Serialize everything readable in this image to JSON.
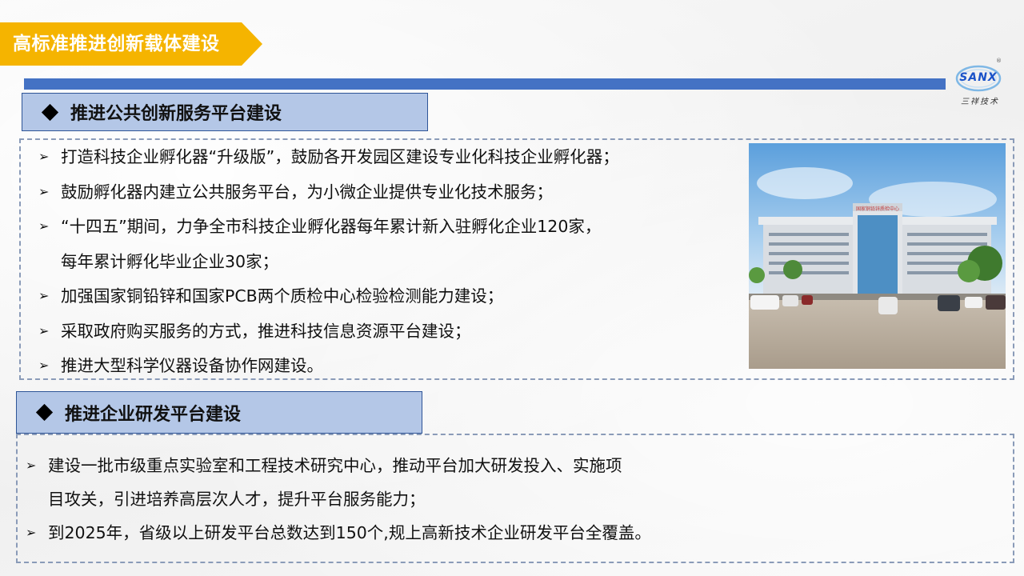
{
  "header": {
    "title": "高标准推进创新载体建设"
  },
  "logo": {
    "brand": "SANX",
    "registered_mark": "®",
    "subtitle": "三祥技术"
  },
  "section1": {
    "heading": "推进公共创新服务平台建设",
    "bullets": [
      "打造科技企业孵化器“升级版”，鼓励各开发园区建设专业化科技企业孵化器；",
      "鼓励孵化器内建立公共服务平台，为小微企业提供专业化技术服务；",
      "“十四五”期间，力争全市科技企业孵化器每年累计新入驻孵化企业120家，",
      "每年累计孵化毕业企业30家；",
      "加强国家铜铅锌和国家PCB两个质检中心检验检测能力建设；",
      "采取政府购买服务的方式，推进科技信息资源平台建设；",
      "推进大型科学仪器设备协作网建设。"
    ],
    "photo_sign": "国家铜铅锌质检中心"
  },
  "section2": {
    "heading": "推进企业研发平台建设",
    "bullets": [
      "建设一批市级重点实验室和工程技术研究中心，推动平台加大研发投入、实施项",
      "目攻关，引进培养高层次人才，提升平台服务能力；",
      "到2025年，省级以上研发平台总数达到150个,规上高新技术企业研发平台全覆盖。"
    ]
  },
  "colors": {
    "title_banner": "#f5b400",
    "rule": "#4472c4",
    "section_header_fill": "#b4c7e7",
    "section_header_border": "#2f5597",
    "box_border": "#8a9bb8"
  },
  "icons": {
    "section_marker": "diamond-icon",
    "bullet": "arrow-bullet-icon"
  }
}
